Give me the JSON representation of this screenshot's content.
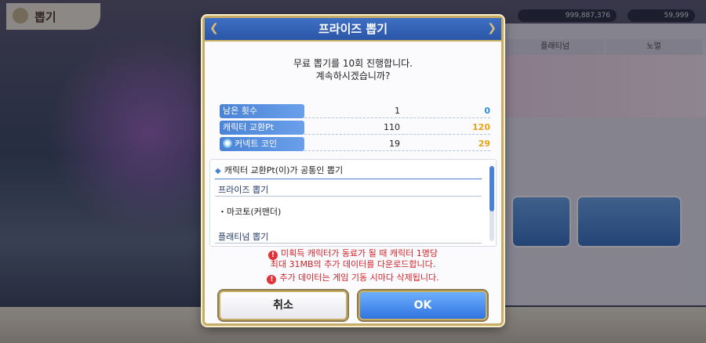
{
  "background": {
    "screen_title": "뽑기",
    "currency_1": "999,887,376",
    "currency_2": "59,999",
    "tabs": [
      "플래티넘",
      "노멀"
    ]
  },
  "dialog": {
    "title": "프라이즈 뽑기",
    "message_line1": "무료 뽑기를 10회 진행합니다.",
    "message_line2": "계속하시겠습니까?",
    "stats": [
      {
        "label": "남은 횟수",
        "before": "1",
        "after": "0",
        "after_color": "#2a8be0"
      },
      {
        "label": "캐릭터 교환Pt",
        "before": "110",
        "after": "120",
        "after_color": "#e8a317"
      },
      {
        "label": "커넥트 코인",
        "before": "19",
        "after": "29",
        "after_color": "#e8a317",
        "icon": "connect-coin-icon"
      }
    ],
    "list": {
      "header": "캐릭터 교환Pt(이)가 공통인 뽑기",
      "section1": "프라이즈 뽑기",
      "item1": "・마코토(커맨더)",
      "section2": "플래티넘 뽑기"
    },
    "warnings": {
      "line1": "미획득 캐릭터가 동료가 될 때 캐릭터 1명당",
      "line2": "최대 31MB의 추가 데이터를 다운로드합니다.",
      "line3": "추가 데이터는 게임 기동 시마다 삭제됩니다."
    },
    "buttons": {
      "cancel": "취소",
      "ok": "OK"
    }
  },
  "colors": {
    "header_blue": "#2b56a8",
    "gold_border": "#c7ad66",
    "warning_red": "#d1232a"
  }
}
